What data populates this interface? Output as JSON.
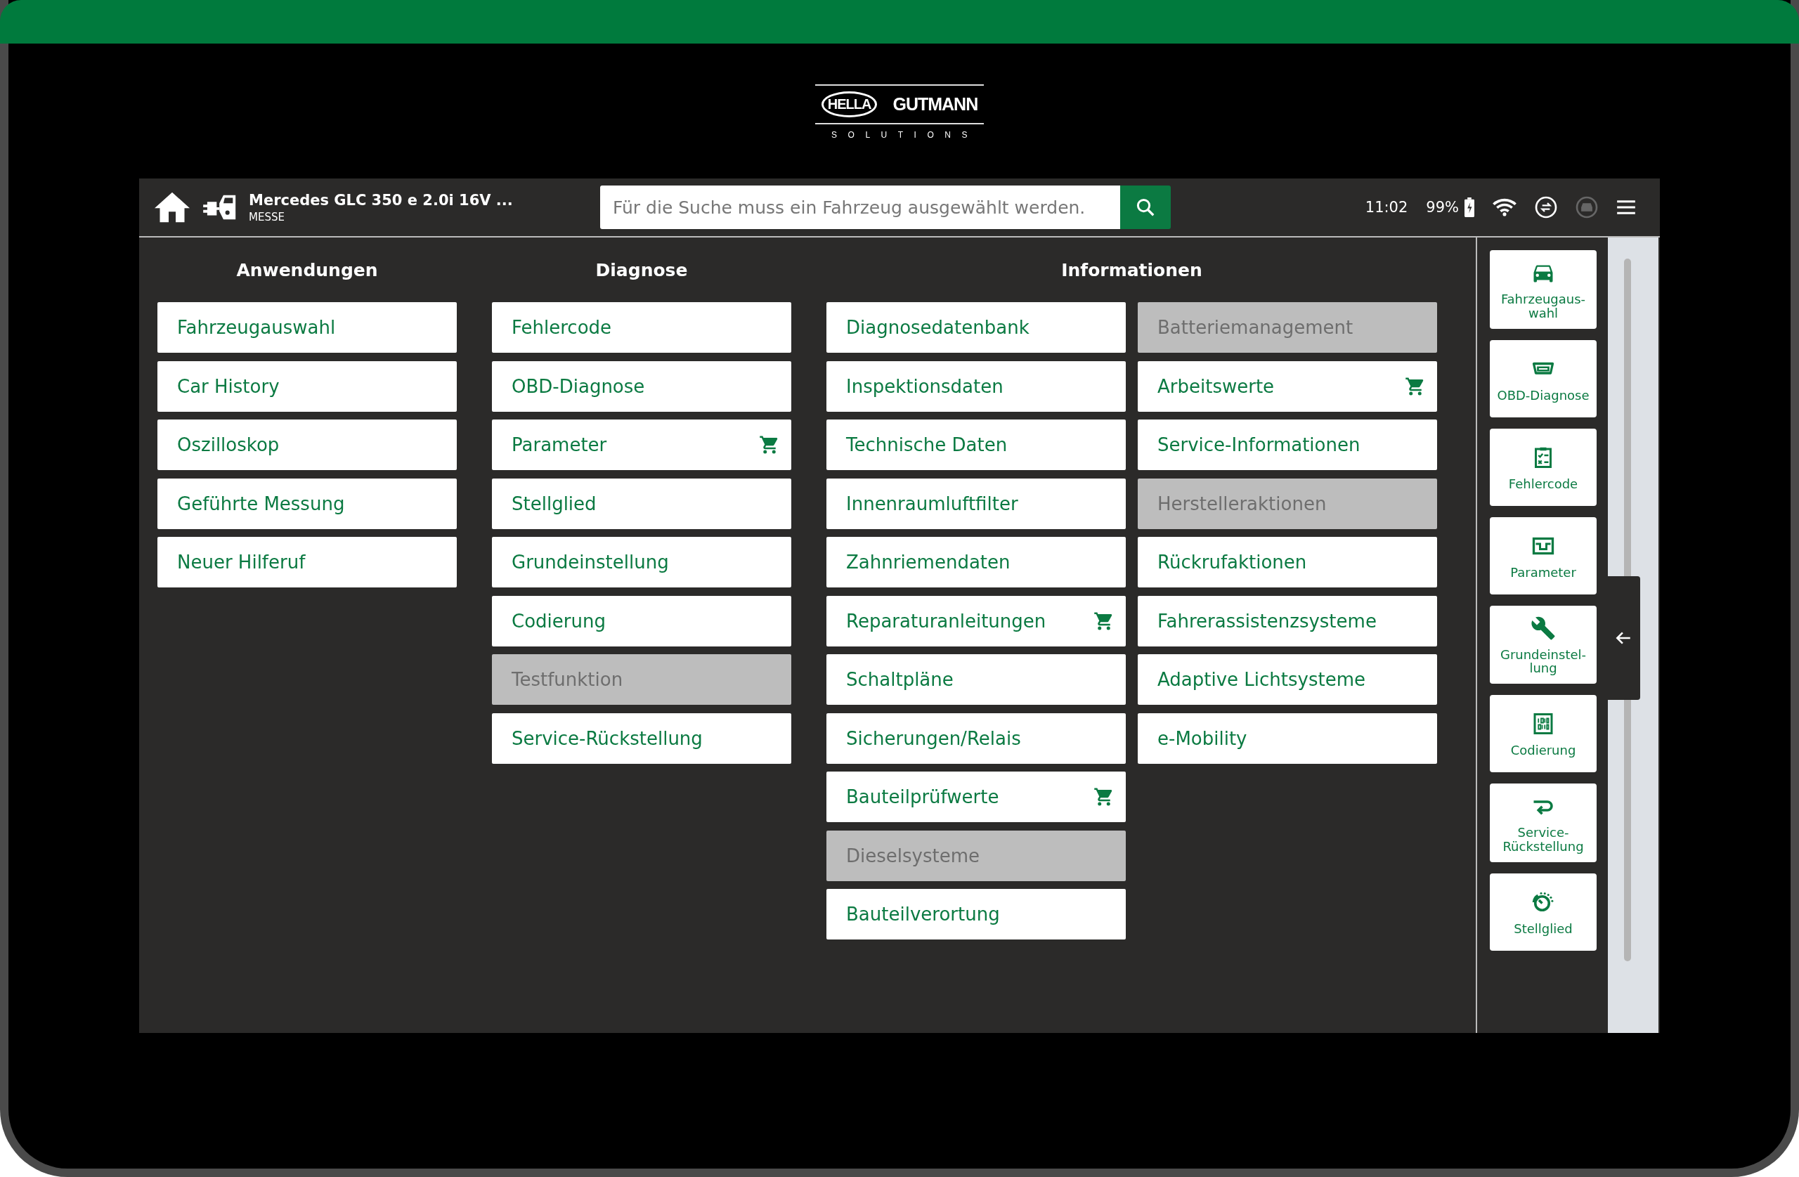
{
  "logo": {
    "brand": "HELLA",
    "name": "GUTMANN",
    "tagline": "SOLUTIONS"
  },
  "header": {
    "vehicle": "Mercedes GLC 350 e 2.0i 16V ...",
    "vehicle_sub": "MESSE",
    "search": {
      "placeholder": "Für die Suche muss ein Fahrzeug ausgewählt werden."
    },
    "time": "11:02",
    "battery": "99%"
  },
  "columns": [
    {
      "title": "Anwendungen",
      "lists": [
        [
          {
            "label": "Fahrzeugauswahl",
            "disabled": false,
            "cart": false
          },
          {
            "label": "Car History",
            "disabled": false,
            "cart": false
          },
          {
            "label": "Oszilloskop",
            "disabled": false,
            "cart": false
          },
          {
            "label": "Geführte Messung",
            "disabled": false,
            "cart": false
          },
          {
            "label": "Neuer Hilferuf",
            "disabled": false,
            "cart": false
          }
        ]
      ]
    },
    {
      "title": "Diagnose",
      "lists": [
        [
          {
            "label": "Fehlercode",
            "disabled": false,
            "cart": false
          },
          {
            "label": "OBD-Diagnose",
            "disabled": false,
            "cart": false
          },
          {
            "label": "Parameter",
            "disabled": false,
            "cart": true
          },
          {
            "label": "Stellglied",
            "disabled": false,
            "cart": false
          },
          {
            "label": "Grundeinstellung",
            "disabled": false,
            "cart": false
          },
          {
            "label": "Codierung",
            "disabled": false,
            "cart": false
          },
          {
            "label": "Testfunktion",
            "disabled": true,
            "cart": false
          },
          {
            "label": "Service-Rückstellung",
            "disabled": false,
            "cart": false
          }
        ]
      ]
    },
    {
      "title": "Informationen",
      "lists": [
        [
          {
            "label": "Diagnosedatenbank",
            "disabled": false,
            "cart": false
          },
          {
            "label": "Inspektionsdaten",
            "disabled": false,
            "cart": false
          },
          {
            "label": "Technische Daten",
            "disabled": false,
            "cart": false
          },
          {
            "label": "Innenraumluftfilter",
            "disabled": false,
            "cart": false
          },
          {
            "label": "Zahnriemendaten",
            "disabled": false,
            "cart": false
          },
          {
            "label": "Reparaturanleitungen",
            "disabled": false,
            "cart": true
          },
          {
            "label": "Schaltpläne",
            "disabled": false,
            "cart": false
          },
          {
            "label": "Sicherungen/Relais",
            "disabled": false,
            "cart": false
          },
          {
            "label": "Bauteilprüfwerte",
            "disabled": false,
            "cart": true
          },
          {
            "label": "Dieselsysteme",
            "disabled": true,
            "cart": false
          },
          {
            "label": "Bauteilverortung",
            "disabled": false,
            "cart": false
          }
        ],
        [
          {
            "label": "Batteriemanagement",
            "disabled": true,
            "cart": false
          },
          {
            "label": "Arbeitswerte",
            "disabled": false,
            "cart": true
          },
          {
            "label": "Service-Informationen",
            "disabled": false,
            "cart": false
          },
          {
            "label": "Herstelleraktionen",
            "disabled": true,
            "cart": false
          },
          {
            "label": "Rückrufaktionen",
            "disabled": false,
            "cart": false
          },
          {
            "label": "Fahrerassistenzsysteme",
            "disabled": false,
            "cart": false
          },
          {
            "label": "Adaptive Lichtsysteme",
            "disabled": false,
            "cart": false
          },
          {
            "label": "e-Mobility",
            "disabled": false,
            "cart": false
          }
        ]
      ]
    }
  ],
  "shortcuts": [
    {
      "label": "Fahrzeugaus-\nwahl",
      "kind": "car"
    },
    {
      "label": "OBD-Diagnose",
      "kind": "obd"
    },
    {
      "label": "Fehlercode",
      "kind": "checklist"
    },
    {
      "label": "Parameter",
      "kind": "signal"
    },
    {
      "label": "Grundeinstel-\nlung",
      "kind": "wrench"
    },
    {
      "label": "Codierung",
      "kind": "binary"
    },
    {
      "label": "Service-\nRückstellung",
      "kind": "return"
    },
    {
      "label": "Stellglied",
      "kind": "gauge"
    }
  ]
}
